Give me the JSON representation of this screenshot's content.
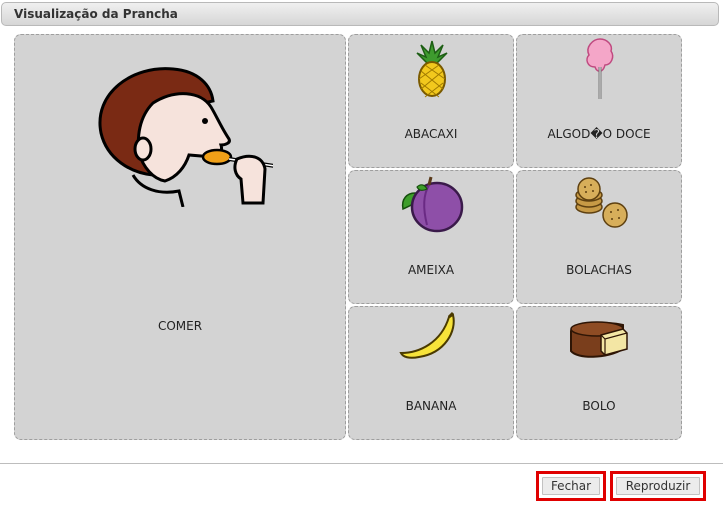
{
  "window": {
    "title": "Visualização da Prancha"
  },
  "board": {
    "main_card": {
      "label": "COMER",
      "icon": "person-eating-icon"
    },
    "cards": [
      {
        "label": "ABACAXI",
        "icon": "pineapple-icon"
      },
      {
        "label": "ALGOD�O DOCE",
        "icon": "cotton-candy-icon"
      },
      {
        "label": "AMEIXA",
        "icon": "plum-icon"
      },
      {
        "label": "BOLACHAS",
        "icon": "cookies-icon"
      },
      {
        "label": "BANANA",
        "icon": "banana-icon"
      },
      {
        "label": "BOLO",
        "icon": "cake-icon"
      }
    ]
  },
  "footer": {
    "close_label": "Fechar",
    "play_label": "Reproduzir"
  },
  "colors": {
    "card_bg": "#d3d3d3",
    "highlight": "#e00000"
  }
}
